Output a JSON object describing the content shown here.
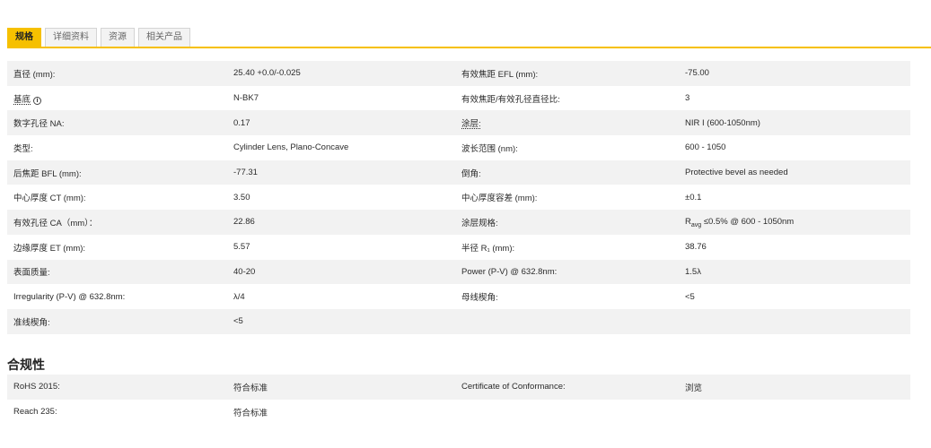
{
  "tabs": [
    "规格",
    "详细资料",
    "资源",
    "相关产品"
  ],
  "specs": [
    [
      "直径 (mm):",
      "25.40 +0.0/-0.025",
      "有效焦距 EFL (mm):",
      "-75.00"
    ],
    [
      "基底",
      "N-BK7",
      "有效焦距/有效孔径直径比:",
      "3"
    ],
    [
      "数字孔径 NA:",
      "0.17",
      "涂层:",
      "NIR I (600-1050nm)"
    ],
    [
      "类型:",
      "Cylinder Lens, Plano-Concave",
      "波长范围 (nm):",
      "600 - 1050"
    ],
    [
      "后焦距 BFL (mm):",
      "-77.31",
      "倒角:",
      "Protective bevel as needed"
    ],
    [
      "中心厚度 CT (mm):",
      "3.50",
      "中心厚度容差 (mm):",
      "±0.1"
    ],
    [
      "有效孔径 CA（mm）：",
      "22.86",
      "涂层规格:",
      "≤0.5% @ 600 - 1050nm"
    ],
    [
      "边缘厚度 ET (mm):",
      "5.57",
      "半径 R₁ (mm):",
      "38.76"
    ],
    [
      "表面质量:",
      "40-20",
      "Power (P-V) @ 632.8nm:",
      "1.5λ"
    ],
    [
      "Irregularity (P-V) @ 632.8nm:",
      "λ/4",
      "母线楔角:",
      "<5"
    ],
    [
      "准线楔角:",
      "<5",
      "",
      ""
    ]
  ],
  "coating_spec_prefix": "R",
  "coating_spec_sub": "avg",
  "compliance_title": "合规性",
  "compliance": [
    [
      "RoHS 2015:",
      "符合标准",
      "Certificate of Conformance:",
      "浏览"
    ],
    [
      "Reach 235:",
      "符合标准",
      "",
      ""
    ]
  ],
  "colors": {
    "accent": "#f6c000",
    "link": "#1d5aa6",
    "stripe": "#f2f2f2"
  }
}
